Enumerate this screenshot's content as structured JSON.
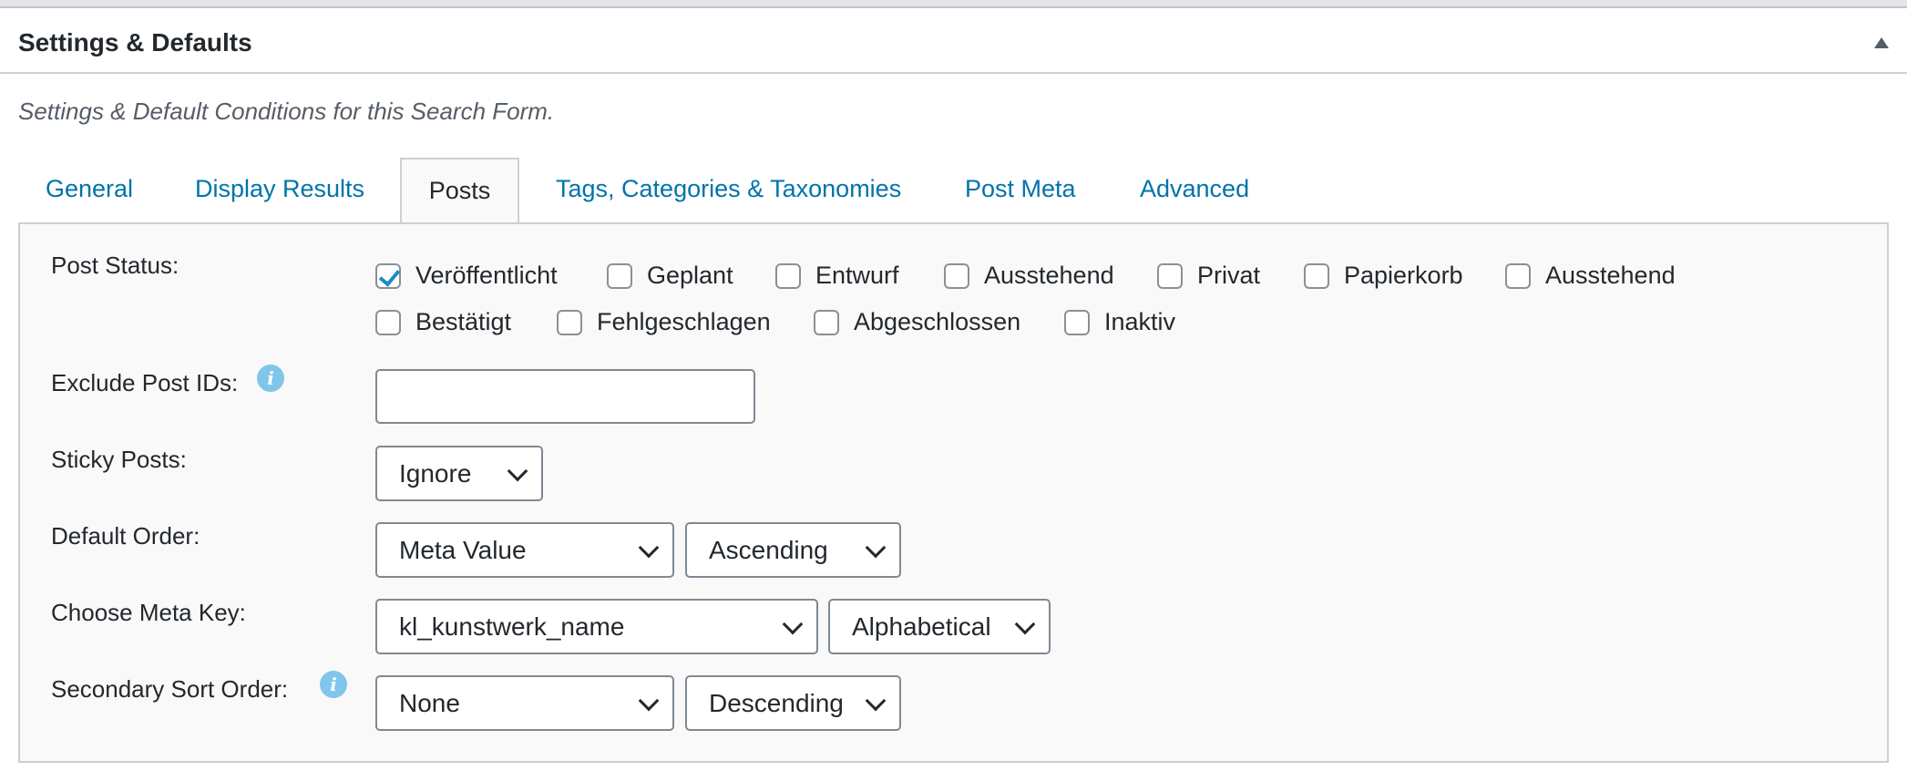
{
  "header": {
    "title": "Settings & Defaults",
    "description": "Settings & Default Conditions for this Search Form."
  },
  "tabs": [
    {
      "label": "General"
    },
    {
      "label": "Display Results"
    },
    {
      "label": "Posts",
      "active": true
    },
    {
      "label": "Tags, Categories & Taxonomies"
    },
    {
      "label": "Post Meta"
    },
    {
      "label": "Advanced"
    }
  ],
  "post_status": {
    "label": "Post Status:",
    "options": [
      {
        "label": "Veröffentlicht",
        "checked": true
      },
      {
        "label": "Geplant",
        "checked": false
      },
      {
        "label": "Entwurf",
        "checked": false
      },
      {
        "label": "Ausstehend",
        "checked": false
      },
      {
        "label": "Privat",
        "checked": false
      },
      {
        "label": "Papierkorb",
        "checked": false
      },
      {
        "label": "Ausstehend",
        "checked": false
      },
      {
        "label": "Bestätigt",
        "checked": false
      },
      {
        "label": "Fehlgeschlagen",
        "checked": false
      },
      {
        "label": "Abgeschlossen",
        "checked": false
      },
      {
        "label": "Inaktiv",
        "checked": false
      }
    ]
  },
  "exclude_ids": {
    "label": "Exclude Post IDs:",
    "value": ""
  },
  "sticky": {
    "label": "Sticky Posts:",
    "value": "Ignore"
  },
  "default_order": {
    "label": "Default Order:",
    "by": "Meta Value",
    "dir": "Ascending"
  },
  "meta_key": {
    "label": "Choose Meta Key:",
    "key": "kl_kunstwerk_name",
    "type": "Alphabetical"
  },
  "secondary_sort": {
    "label": "Secondary Sort Order:",
    "by": "None",
    "dir": "Descending"
  },
  "info_icon_glyph": "i",
  "colors": {
    "link": "#0073aa",
    "checkmark": "#1e8cbe",
    "info": "#7fc6ea"
  }
}
